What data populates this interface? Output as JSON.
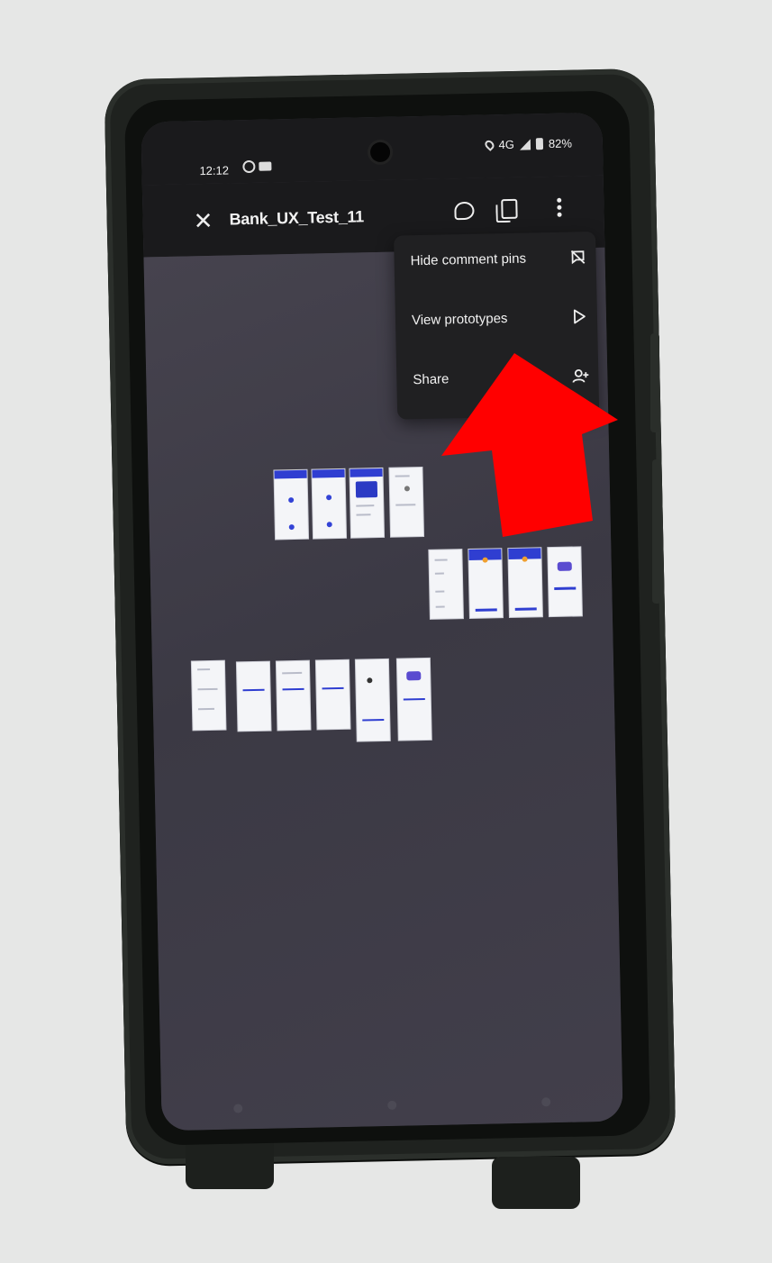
{
  "status_bar": {
    "time": "12:12",
    "network": "4G",
    "battery": "82%"
  },
  "app_bar": {
    "title": "Bank_UX_Test_11",
    "close_icon": "close-icon",
    "comment_icon": "comment-icon",
    "copy_icon": "copy-icon",
    "more_icon": "more-vertical-icon"
  },
  "menu": {
    "items": [
      {
        "label": "Hide comment pins",
        "icon": "comment-off-icon"
      },
      {
        "label": "View prototypes",
        "icon": "play-icon"
      },
      {
        "label": "Share",
        "icon": "person-add-icon"
      }
    ]
  },
  "annotation": {
    "arrow_color": "#ff0000",
    "points_to": "View prototypes"
  },
  "colors": {
    "canvas": "#3c3a43",
    "frame_accent": "#2f3ed1",
    "menu_bg": "#202022"
  }
}
